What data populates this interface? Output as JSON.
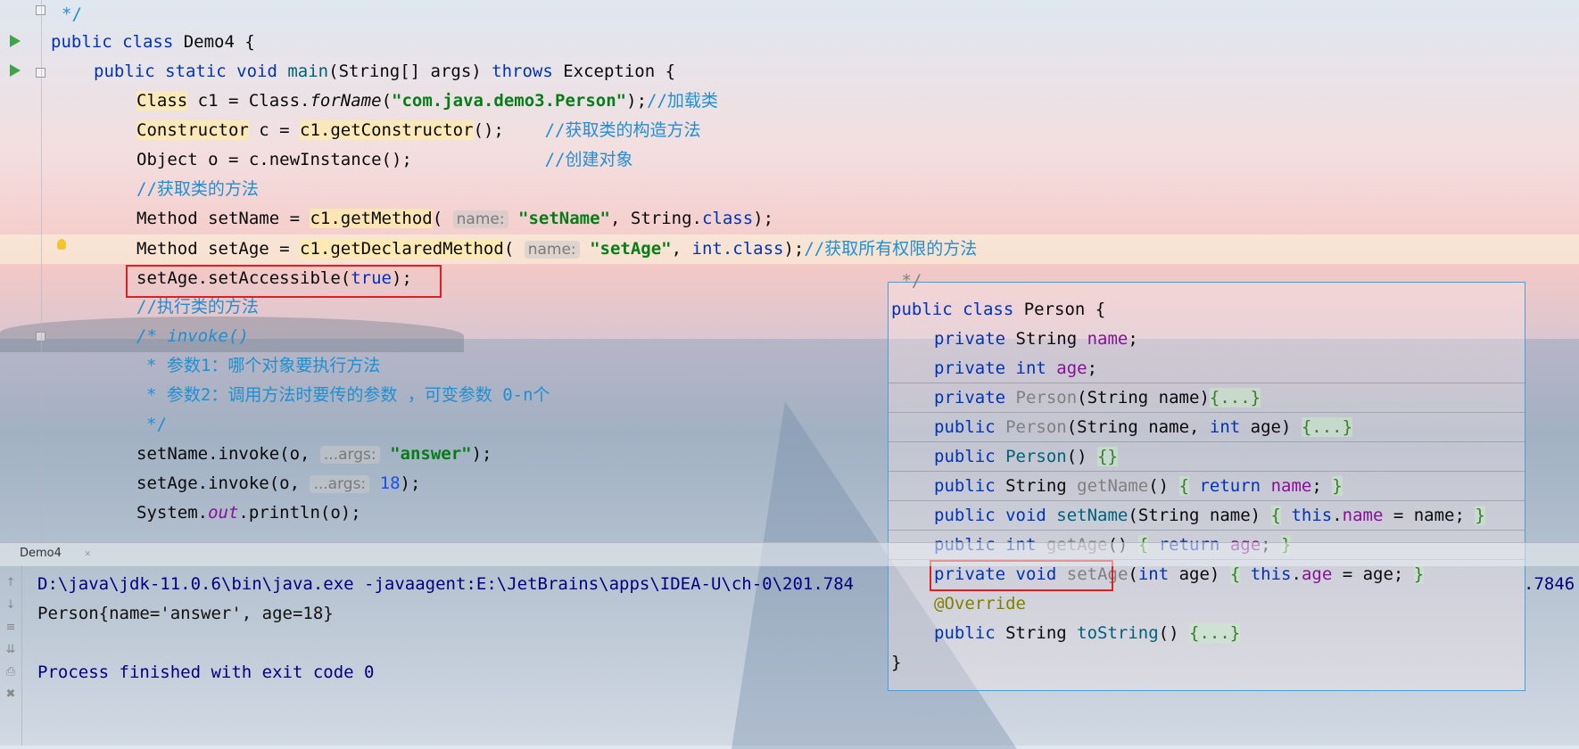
{
  "editor": {
    "code_lines": [
      "*/",
      "public class Demo4 {",
      "public static void main(String[] args) throws Exception {",
      "Class c1 = Class.forName(\"com.java.demo3.Person\");//加载类",
      "Constructor c = c1.getConstructor();    //获取类的构造方法",
      "Object o = c.newInstance();             //创建对象",
      "//获取类的方法",
      "Method setName = c1.getMethod( name: \"setName\", String.class);",
      "Method setAge = c1.getDeclaredMethod( name: \"setAge\", int.class);//获取所有权限的方法",
      "setAge.setAccessible(true);",
      "//执行类的方法",
      "/* invoke()",
      "* 参数1：哪个对象要执行方法",
      "* 参数2：调用方法时要传的参数 ，可变参数 0-n个",
      "*/",
      "setName.invoke(o, ...args: \"answer\");",
      "setAge.invoke(o, ...args: 18);",
      "System.out.println(o);"
    ]
  },
  "popup": {
    "lines": [
      "public class Person {",
      "private String name;",
      "private int age;",
      "private Person(String name){...}",
      "public Person(String name, int age) {...}",
      "public Person() {}",
      "public String getName() { return name; }",
      "public void setName(String name) { this.name = name; }",
      "public int getAge() { return age; }",
      "private void setAge(int age) { this.age = age; }",
      "@Override",
      "public String toString() {...}",
      "}"
    ]
  },
  "run_tab": {
    "label": "Demo4"
  },
  "console": {
    "command": "D:\\java\\jdk-11.0.6\\bin\\java.exe -javaagent:E:\\JetBrains\\apps\\IDEA-U\\ch-0\\201.784",
    "command_tail": ".7846",
    "output": "Person{name='answer', age=18}",
    "exit": "Process finished with exit code 0"
  },
  "colors": {
    "keyword": "#0033b3",
    "string": "#067d17",
    "comment": "#1f8fd1",
    "highlight_box": "#e02020",
    "popup_border": "#4c9ed9"
  },
  "icons": [
    "run-icon",
    "bulb-icon",
    "fold-icon",
    "console-up-icon",
    "console-down-icon",
    "soft-wrap-icon",
    "scroll-end-icon",
    "print-icon",
    "trash-icon"
  ]
}
